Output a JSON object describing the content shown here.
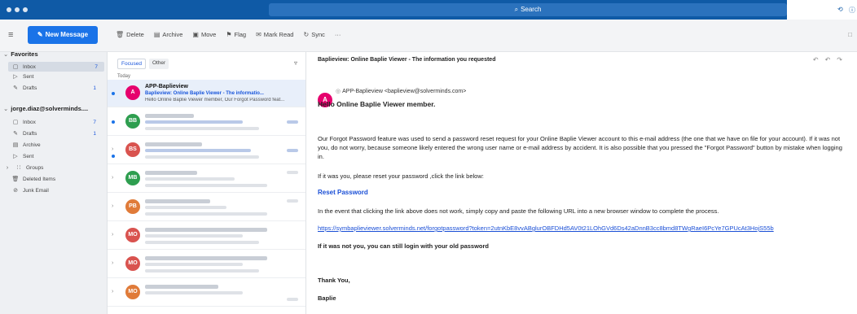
{
  "titlebar": {
    "search_label": "Search",
    "search_icon": "search-icon"
  },
  "toolbar": {
    "new_message": "New Message",
    "actions": [
      "Delete",
      "Archive",
      "Move",
      "Flag",
      "Mark Read",
      "Sync",
      "···"
    ]
  },
  "sidebar": {
    "favorites": {
      "title": "Favorites",
      "items": [
        {
          "label": "Inbox",
          "count": "7"
        },
        {
          "label": "Sent",
          "count": ""
        },
        {
          "label": "Drafts",
          "count": "1"
        }
      ]
    },
    "account": {
      "title": "jorge.diaz@solverminds....",
      "items": [
        {
          "label": "Inbox",
          "count": "7"
        },
        {
          "label": "Drafts",
          "count": "1"
        },
        {
          "label": "Archive",
          "count": ""
        },
        {
          "label": "Sent",
          "count": ""
        },
        {
          "label": "Groups",
          "count": ""
        },
        {
          "label": "Deleted Items",
          "count": ""
        },
        {
          "label": "Junk Email",
          "count": ""
        }
      ]
    }
  },
  "message_list": {
    "tabs": [
      "Focused",
      "Other"
    ],
    "day_header": "Today",
    "selected_message": {
      "avatar": "A",
      "sender": "APP-Baplieview",
      "subject": "Baplieview: Online Baplie Viewer - The informatio...",
      "preview": "Hello Online Baplie Viewer member, Our Forgot Password feat..."
    },
    "other_avatars": [
      "BB",
      "BS",
      "MB",
      "PB",
      "MO",
      "MO",
      "MO"
    ]
  },
  "reading_pane": {
    "subject": "Baplieview: Online Baplie Viewer - The information you requested",
    "sender_avatar": "A",
    "from": "APP-Baplieview <baplieview@solverminds.com>",
    "greeting": "Hello Online Baplie Viewer member.",
    "paragraph1": "Our Forgot Password feature was used to send a password reset request for your Online Baplie Viewer account to this e-mail address (the one that we have on file for your account). If it was not you, do not worry, because someone likely entered the wrong user name or e-mail address by accident. It is also possible that you pressed the \"Forgot Password\" button by mistake when logging in.",
    "paragraph2": "If it was you, please reset your password ,click the link below:",
    "reset_link": "Reset Password",
    "paragraph3": "In the event that clicking the link above does not work, simply copy and paste the following URL into a new browser window to complete the process.",
    "url": "https://symbaplieviewer.solverminds.net/forgotpassword?token=2utnKbE8vvABglurOBFDHd5AV0t21LOhGVd6Ds42aDnnB3cc8bmd8TWgRaeI6PcYe7GPUcAt3HojS55b",
    "paragraph4": "If it was not you, you can still login with your old password",
    "sign_off": "Thank You,",
    "signature": "Baplie"
  },
  "colors": {
    "brand_blue": "#0f5aa6",
    "new_message_blue": "#1a73e8",
    "avatar_pink": "#e6006d",
    "avatar_green": "#2e9e4f",
    "avatar_red": "#d9534f",
    "avatar_orange": "#e07b39"
  }
}
